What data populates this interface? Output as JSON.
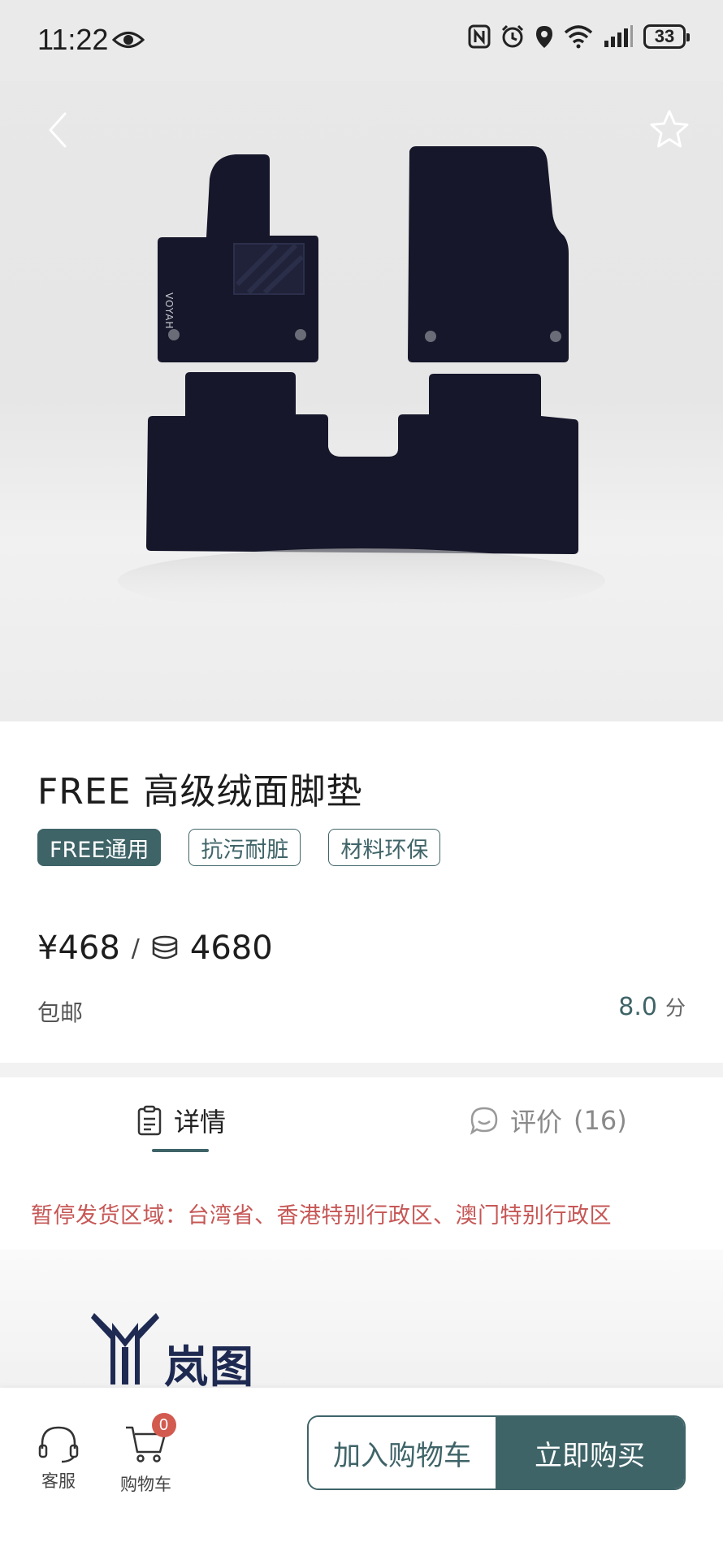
{
  "status_bar": {
    "time": "11:22",
    "battery": "33"
  },
  "product": {
    "title": "FREE 高级绒面脚垫",
    "tags": [
      "FREE通用",
      "抗污耐脏",
      "材料环保"
    ],
    "price": "¥468",
    "price_separator": "/",
    "points": "4680",
    "shipping": "包邮",
    "score": "8.0",
    "score_unit": "分"
  },
  "tabs": {
    "detail": "详情",
    "review": "评价",
    "review_count": "(16)"
  },
  "notice": "暂停发货区域：台湾省、香港特别行政区、澳门特别行政区",
  "brand": {
    "name": "岚图"
  },
  "bottom_bar": {
    "service_label": "客服",
    "cart_label": "购物车",
    "cart_count": "0",
    "add_to_cart": "加入购物车",
    "buy_now": "立即购买"
  },
  "colors": {
    "accent": "#3f6468",
    "notice": "#c65755",
    "badge": "#d25a4f"
  }
}
